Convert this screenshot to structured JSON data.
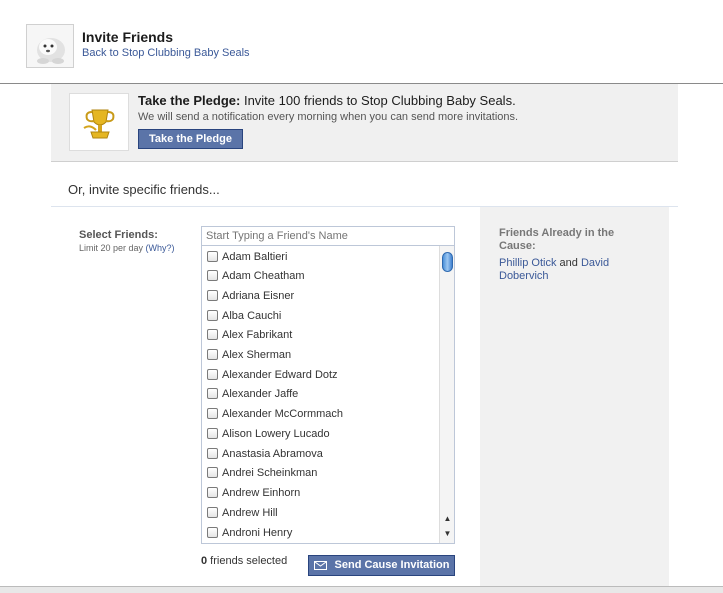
{
  "header": {
    "title": "Invite Friends",
    "back_link": "Back to Stop Clubbing Baby Seals"
  },
  "pledge": {
    "heading_bold": "Take the Pledge:",
    "heading_rest": " Invite 100 friends to Stop Clubbing Baby Seals.",
    "subtext": "We will send a notification every morning when you can send more invitations.",
    "button_label": "Take the Pledge"
  },
  "or_line": "Or, invite specific friends...",
  "select": {
    "label": "Select Friends:",
    "limit_text": "Limit 20 per day ",
    "why_link": "(Why?)",
    "search_placeholder": "Start Typing a Friend's Name"
  },
  "friends": [
    "Adam Baltieri",
    "Adam Cheatham",
    "Adriana Eisner",
    "Alba Cauchi",
    "Alex Fabrikant",
    "Alex Sherman",
    "Alexander Edward Dotz",
    "Alexander Jaffe",
    "Alexander McCormmach",
    "Alison Lowery Lucado",
    "Anastasia Abramova",
    "Andrei Scheinkman",
    "Andrew Einhorn",
    "Andrew Hill",
    "Androni Henry"
  ],
  "footer": {
    "count": "0",
    "count_suffix": " friends selected",
    "send_label": "Send Cause Invitation"
  },
  "side": {
    "title": "Friends Already in the Cause:",
    "friend1": "Phillip Otick",
    "and_text": " and ",
    "friend2": "David Dobervich"
  },
  "colors": {
    "link": "#3b5998",
    "button_bg": "#5b74a8",
    "panel_bg": "#f0f0f0"
  }
}
